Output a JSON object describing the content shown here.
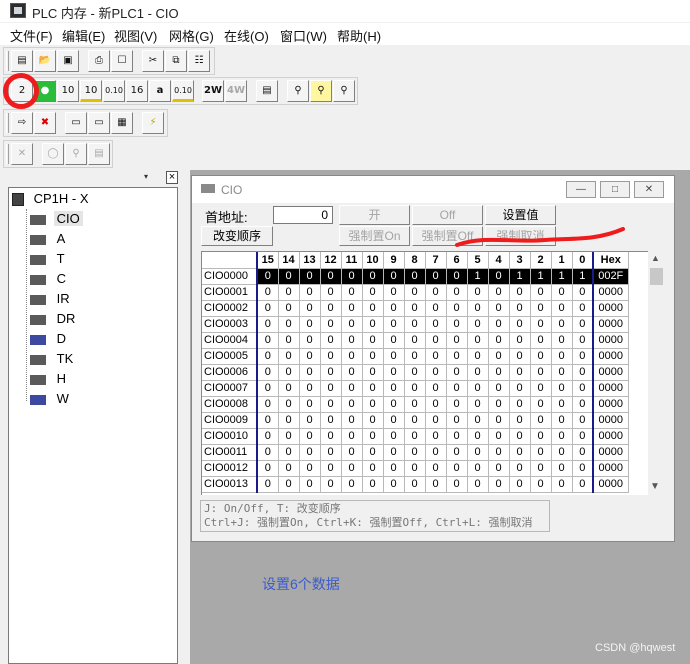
{
  "window": {
    "title": "PLC 内存 - 新PLC1 - CIO"
  },
  "menu": [
    "文件(F)",
    "编辑(E)",
    "视图(V)",
    "网格(G)",
    "在线(O)",
    "窗口(W)",
    "帮助(H)"
  ],
  "toolbar_row2": [
    "2",
    "10",
    "10",
    "0.10",
    "16",
    "a",
    "0.10",
    "2W",
    "4W"
  ],
  "tree": {
    "root": "CP1H - X",
    "items": [
      "CIO",
      "A",
      "T",
      "C",
      "IR",
      "DR",
      "D",
      "TK",
      "H",
      "W"
    ]
  },
  "cio": {
    "title": "CIO",
    "start_address_label": "首地址:",
    "start_address_value": "0",
    "change_order_button": "改变顺序",
    "on_button": "开",
    "off_button": "Off",
    "set_value_button": "设置值",
    "force_on_button": "强制置On",
    "force_off_button": "强制置Off",
    "force_cancel_button": "强制取消",
    "columns": [
      "15",
      "14",
      "13",
      "12",
      "11",
      "10",
      "9",
      "8",
      "7",
      "6",
      "5",
      "4",
      "3",
      "2",
      "1",
      "0",
      "Hex"
    ],
    "rows": [
      {
        "label": "CIO0000",
        "bits": [
          "0",
          "0",
          "0",
          "0",
          "0",
          "0",
          "0",
          "0",
          "0",
          "0",
          "1",
          "0",
          "1",
          "1",
          "1",
          "1"
        ],
        "hex": "002F"
      },
      {
        "label": "CIO0001",
        "bits": [
          "0",
          "0",
          "0",
          "0",
          "0",
          "0",
          "0",
          "0",
          "0",
          "0",
          "0",
          "0",
          "0",
          "0",
          "0",
          "0"
        ],
        "hex": "0000"
      },
      {
        "label": "CIO0002",
        "bits": [
          "0",
          "0",
          "0",
          "0",
          "0",
          "0",
          "0",
          "0",
          "0",
          "0",
          "0",
          "0",
          "0",
          "0",
          "0",
          "0"
        ],
        "hex": "0000"
      },
      {
        "label": "CIO0003",
        "bits": [
          "0",
          "0",
          "0",
          "0",
          "0",
          "0",
          "0",
          "0",
          "0",
          "0",
          "0",
          "0",
          "0",
          "0",
          "0",
          "0"
        ],
        "hex": "0000"
      },
      {
        "label": "CIO0004",
        "bits": [
          "0",
          "0",
          "0",
          "0",
          "0",
          "0",
          "0",
          "0",
          "0",
          "0",
          "0",
          "0",
          "0",
          "0",
          "0",
          "0"
        ],
        "hex": "0000"
      },
      {
        "label": "CIO0005",
        "bits": [
          "0",
          "0",
          "0",
          "0",
          "0",
          "0",
          "0",
          "0",
          "0",
          "0",
          "0",
          "0",
          "0",
          "0",
          "0",
          "0"
        ],
        "hex": "0000"
      },
      {
        "label": "CIO0006",
        "bits": [
          "0",
          "0",
          "0",
          "0",
          "0",
          "0",
          "0",
          "0",
          "0",
          "0",
          "0",
          "0",
          "0",
          "0",
          "0",
          "0"
        ],
        "hex": "0000"
      },
      {
        "label": "CIO0007",
        "bits": [
          "0",
          "0",
          "0",
          "0",
          "0",
          "0",
          "0",
          "0",
          "0",
          "0",
          "0",
          "0",
          "0",
          "0",
          "0",
          "0"
        ],
        "hex": "0000"
      },
      {
        "label": "CIO0008",
        "bits": [
          "0",
          "0",
          "0",
          "0",
          "0",
          "0",
          "0",
          "0",
          "0",
          "0",
          "0",
          "0",
          "0",
          "0",
          "0",
          "0"
        ],
        "hex": "0000"
      },
      {
        "label": "CIO0009",
        "bits": [
          "0",
          "0",
          "0",
          "0",
          "0",
          "0",
          "0",
          "0",
          "0",
          "0",
          "0",
          "0",
          "0",
          "0",
          "0",
          "0"
        ],
        "hex": "0000"
      },
      {
        "label": "CIO0010",
        "bits": [
          "0",
          "0",
          "0",
          "0",
          "0",
          "0",
          "0",
          "0",
          "0",
          "0",
          "0",
          "0",
          "0",
          "0",
          "0",
          "0"
        ],
        "hex": "0000"
      },
      {
        "label": "CIO0011",
        "bits": [
          "0",
          "0",
          "0",
          "0",
          "0",
          "0",
          "0",
          "0",
          "0",
          "0",
          "0",
          "0",
          "0",
          "0",
          "0",
          "0"
        ],
        "hex": "0000"
      },
      {
        "label": "CIO0012",
        "bits": [
          "0",
          "0",
          "0",
          "0",
          "0",
          "0",
          "0",
          "0",
          "0",
          "0",
          "0",
          "0",
          "0",
          "0",
          "0",
          "0"
        ],
        "hex": "0000"
      },
      {
        "label": "CIO0013",
        "bits": [
          "0",
          "0",
          "0",
          "0",
          "0",
          "0",
          "0",
          "0",
          "0",
          "0",
          "0",
          "0",
          "0",
          "0",
          "0",
          "0"
        ],
        "hex": "0000"
      }
    ],
    "hint_line1": "J: On/Off,   T: 改变顺序",
    "hint_line2": "Ctrl+J: 强制置On,  Ctrl+K: 强制置Off,  Ctrl+L: 强制取消"
  },
  "caption": "设置6个数据",
  "watermark": "CSDN @hqwest",
  "colors": {
    "annotation_red": "#ee1c1c",
    "caption_blue": "#3b5ccc",
    "grid_divider": "#1a1a8a"
  }
}
